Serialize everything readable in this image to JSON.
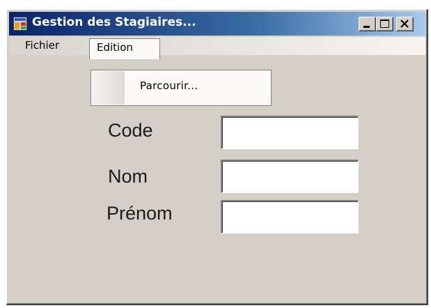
{
  "window": {
    "title": "Gestion des Stagiaires...",
    "icon": "app-window-icon",
    "controls": [
      "minimize-icon",
      "maximize-icon",
      "close-icon"
    ]
  },
  "menubar": {
    "items": [
      {
        "label": "Fichier"
      },
      {
        "label": "Edition",
        "open": true
      }
    ]
  },
  "dropdown": {
    "items": [
      {
        "label": "Parcourir..."
      }
    ]
  },
  "form": {
    "fields": [
      {
        "label": "Code",
        "value": ""
      },
      {
        "label": "Nom",
        "value": ""
      },
      {
        "label": "Prénom",
        "value": ""
      }
    ]
  },
  "colors": {
    "titlebar_start": "#0a246a",
    "titlebar_end": "#a6caf0",
    "face": "#d4d0c8"
  }
}
